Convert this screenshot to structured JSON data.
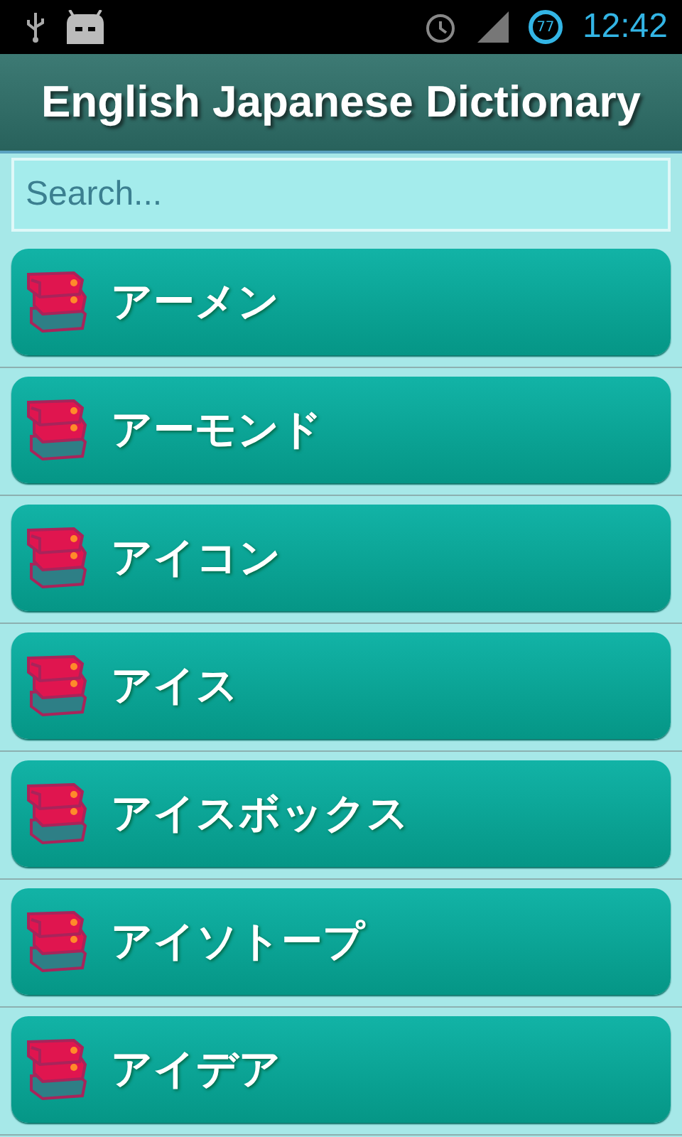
{
  "status_bar": {
    "time": "12:42",
    "battery": "77"
  },
  "title": "English Japanese Dictionary",
  "search": {
    "placeholder": "Search..."
  },
  "words": [
    {
      "text": "アーメン"
    },
    {
      "text": "アーモンド"
    },
    {
      "text": "アイコン"
    },
    {
      "text": "アイス"
    },
    {
      "text": "アイスボックス"
    },
    {
      "text": "アイソトープ"
    },
    {
      "text": "アイデア"
    }
  ]
}
